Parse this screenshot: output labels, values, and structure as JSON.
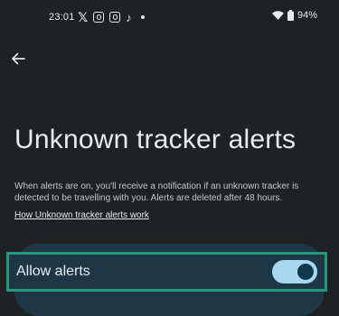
{
  "status_bar": {
    "time": "23:01",
    "notification_icons": [
      "x-icon",
      "instagram-icon",
      "instagram-icon",
      "tiktok-icon",
      "dot-icon"
    ],
    "battery": "94%"
  },
  "page": {
    "title": "Unknown tracker alerts",
    "description": "When alerts are on, you'll receive a notification if an unknown tracker is detected to be travelling with you. Alerts are deleted after 48 hours.",
    "help_link": "How Unknown tracker alerts work"
  },
  "setting": {
    "label": "Allow alerts",
    "enabled": true
  },
  "colors": {
    "background": "#1f2224",
    "card": "#1e3746",
    "focus_ring": "#1f9a7c",
    "toggle_track": "#a8d8f0",
    "toggle_thumb": "#0f3a4d"
  }
}
